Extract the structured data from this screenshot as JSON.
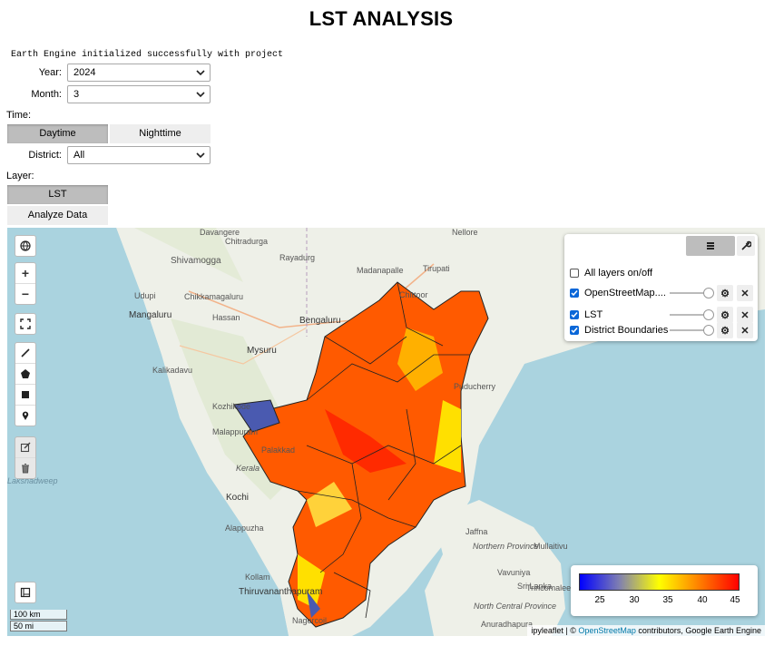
{
  "title": "LST ANALYSIS",
  "init_message": "Earth Engine initialized successfully with project",
  "controls": {
    "year": {
      "label": "Year:",
      "value": "2024"
    },
    "month": {
      "label": "Month:",
      "value": "3"
    },
    "time_label": "Time:",
    "time_options": [
      "Daytime",
      "Nighttime"
    ],
    "time_selected": "Daytime",
    "district": {
      "label": "District:",
      "value": "All"
    },
    "layer_label": "Layer:",
    "layer_button": "LST",
    "analyze_button": "Analyze Data"
  },
  "map": {
    "layer_control": {
      "all_label": "All layers on/off",
      "all_checked": false,
      "layers": [
        {
          "name": "OpenStreetMap....",
          "checked": true
        },
        {
          "name": "LST",
          "checked": true
        },
        {
          "name": "District Boundaries",
          "checked": true
        }
      ]
    },
    "legend": {
      "ticks": [
        "25",
        "30",
        "35",
        "40",
        "45"
      ],
      "colors": [
        "#0000ff",
        "#ffff00",
        "#ff0000"
      ]
    },
    "scale": {
      "km": "100 km",
      "mi": "50 mi"
    },
    "attribution": {
      "prefix": "ipyleaflet | © ",
      "link": "OpenStreetMap",
      "suffix": " contributors, Google Earth Engine"
    },
    "place_labels": [
      "Davangere",
      "Chitradurga",
      "Nellore",
      "Shivamogga",
      "Rayadurg",
      "Madanapalle",
      "Tirupati",
      "Udupi",
      "Chikkamagaluru",
      "Chittoor",
      "Mangaluru",
      "Hassan",
      "Bengaluru",
      "Mysuru",
      "Kalikadavu",
      "Kozhikode",
      "Malappuram",
      "Palakkad",
      "Kerala",
      "Lakshadweep",
      "Kochi",
      "Alappuzha",
      "Kollam",
      "Thiruvananthapuram",
      "Nagercoil",
      "Jaffna",
      "Northern Province",
      "Mullaitivu",
      "Vavuniya",
      "Sri Lanka",
      "Trincomalee",
      "North Central Province",
      "Anuradhapura",
      "Puducherry"
    ]
  }
}
